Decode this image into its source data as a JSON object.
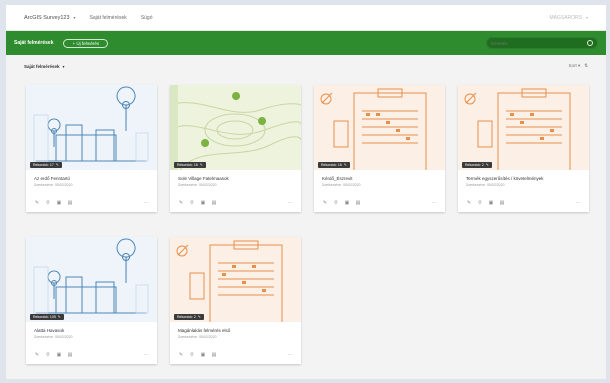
{
  "topbar": {
    "app_title": "ArcGIS Survey123",
    "nav": [
      "Saját felmérések",
      "Súgó"
    ],
    "user": "MAGSARORS"
  },
  "greenbar": {
    "title": "Saját felmérések",
    "new_button": "+ Új felmérés",
    "search_placeholder": "Keresés"
  },
  "subbar": {
    "filter": "Saját felmérések",
    "sort": "Sort ▾"
  },
  "colors": {
    "green": "#2e8b2e",
    "dark_green": "#1f6e1f",
    "badge": "#3a3a3a",
    "orange_thumb": "#e8904a",
    "blue_thumb": "#4c86b8"
  },
  "cards": [
    {
      "name": "Az erdő Fenntartó",
      "date": "Szerkesztve: 05/02/2020",
      "badge": "Rekordok: 17",
      "thumb": "city-pins-icon"
    },
    {
      "name": "Sole Village Fatelmaasok",
      "date": "Szerkesztve: 05/02/2020",
      "badge": "Rekordok: 16",
      "thumb": "contour-map-icon"
    },
    {
      "name": "Kérdő_Észrevit",
      "date": "Szerkesztve: 05/02/2020",
      "badge": "Rekordok: 16",
      "thumb": "clipboard-form-icon"
    },
    {
      "name": "Termék egyszerűsítés / követelmények",
      "date": "Szerkesztve: 05/02/2020",
      "badge": "Rekordok: 2",
      "thumb": "clipboard-form-icon"
    },
    {
      "name": "Alatta Havasok",
      "date": "Szerkesztve: 05/02/2020",
      "badge": "Rekordok: 105",
      "thumb": "city-pins-icon"
    },
    {
      "name": "Magánlakás felmérés első",
      "date": "Szerkesztve: 05/02/2020",
      "badge": "Rekordok: 2",
      "thumb": "clipboard-form-icon"
    }
  ],
  "card_actions": [
    "edit-icon",
    "share-icon",
    "collaborate-icon",
    "results-icon",
    "more-icon"
  ]
}
